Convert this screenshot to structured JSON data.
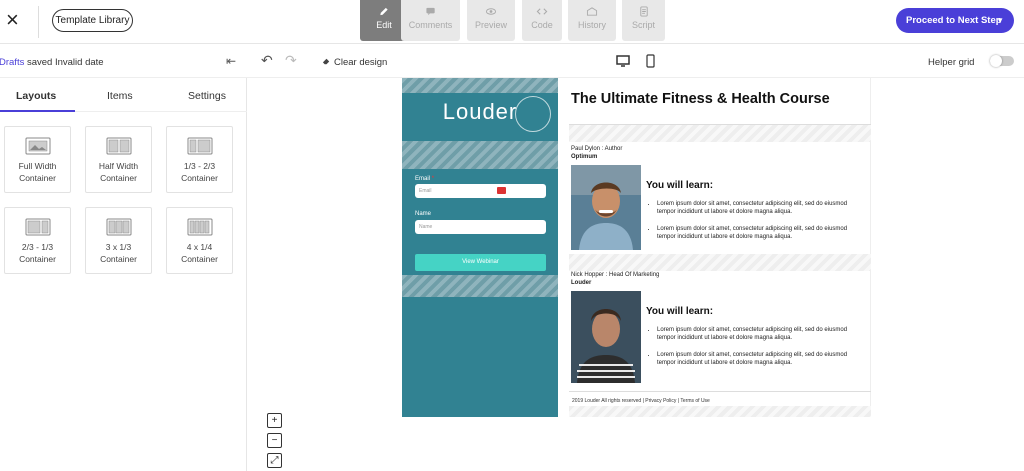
{
  "topbar": {
    "template_library": "Template Library",
    "modes": [
      {
        "label": "Edit",
        "icon": "pencil-icon"
      },
      {
        "label": "Comments",
        "icon": "comment-icon"
      },
      {
        "label": "Preview",
        "icon": "eye-icon"
      },
      {
        "label": "Code",
        "icon": "code-icon"
      },
      {
        "label": "History",
        "icon": "history-icon"
      },
      {
        "label": "Script",
        "icon": "script-icon"
      }
    ],
    "proceed": "Proceed to Next Step",
    "accent": "#4a3fd8"
  },
  "toolbar": {
    "drafts_link": "Drafts",
    "drafts_status": " saved Invalid date",
    "clear_design": "Clear design",
    "helper_grid": "Helper grid"
  },
  "sidebar": {
    "tabs": [
      "Layouts",
      "Items",
      "Settings"
    ],
    "tiles": [
      {
        "line1": "Full Width",
        "line2": "Container"
      },
      {
        "line1": "Half Width",
        "line2": "Container"
      },
      {
        "line1": "1/3 - 2/3",
        "line2": "Container"
      },
      {
        "line1": "2/3 - 1/3",
        "line2": "Container"
      },
      {
        "line1": "3 x 1/3",
        "line2": "Container"
      },
      {
        "line1": "4 x 1/4",
        "line2": "Container"
      }
    ]
  },
  "zoom": {
    "in": "+",
    "out": "−",
    "fit": "⤢"
  },
  "page": {
    "logo": "Louder",
    "form": {
      "email_label": "Email",
      "email_placeholder": "Email",
      "name_label": "Name",
      "name_placeholder": "Name",
      "button": "View Webinar"
    },
    "title": "The Ultimate Fitness & Health Course",
    "speakers": [
      {
        "role": "Paul Dylon : Author",
        "company": "Optimum",
        "heading": "You will learn:",
        "bullets": [
          "Lorem ipsum dolor sit amet, consectetur adipiscing elit, sed do eiusmod tempor incididunt ut labore et dolore magna aliqua.",
          "Lorem ipsum dolor sit amet, consectetur adipiscing elit, sed do eiusmod tempor incididunt ut labore et dolore magna aliqua."
        ]
      },
      {
        "role": "Nick Hopper : Head Of Marketing",
        "company": "Louder",
        "heading": "You will learn:",
        "bullets": [
          "Lorem ipsum dolor sit amet, consectetur adipiscing elit, sed do eiusmod tempor incididunt ut labore et dolore magna aliqua.",
          "Lorem ipsum dolor sit amet, consectetur adipiscing elit, sed do eiusmod tempor incididunt ut labore et dolore magna aliqua."
        ]
      }
    ],
    "footer": "2019 Louder All rights reserved  |  Privacy Policy | Terms of Use"
  }
}
